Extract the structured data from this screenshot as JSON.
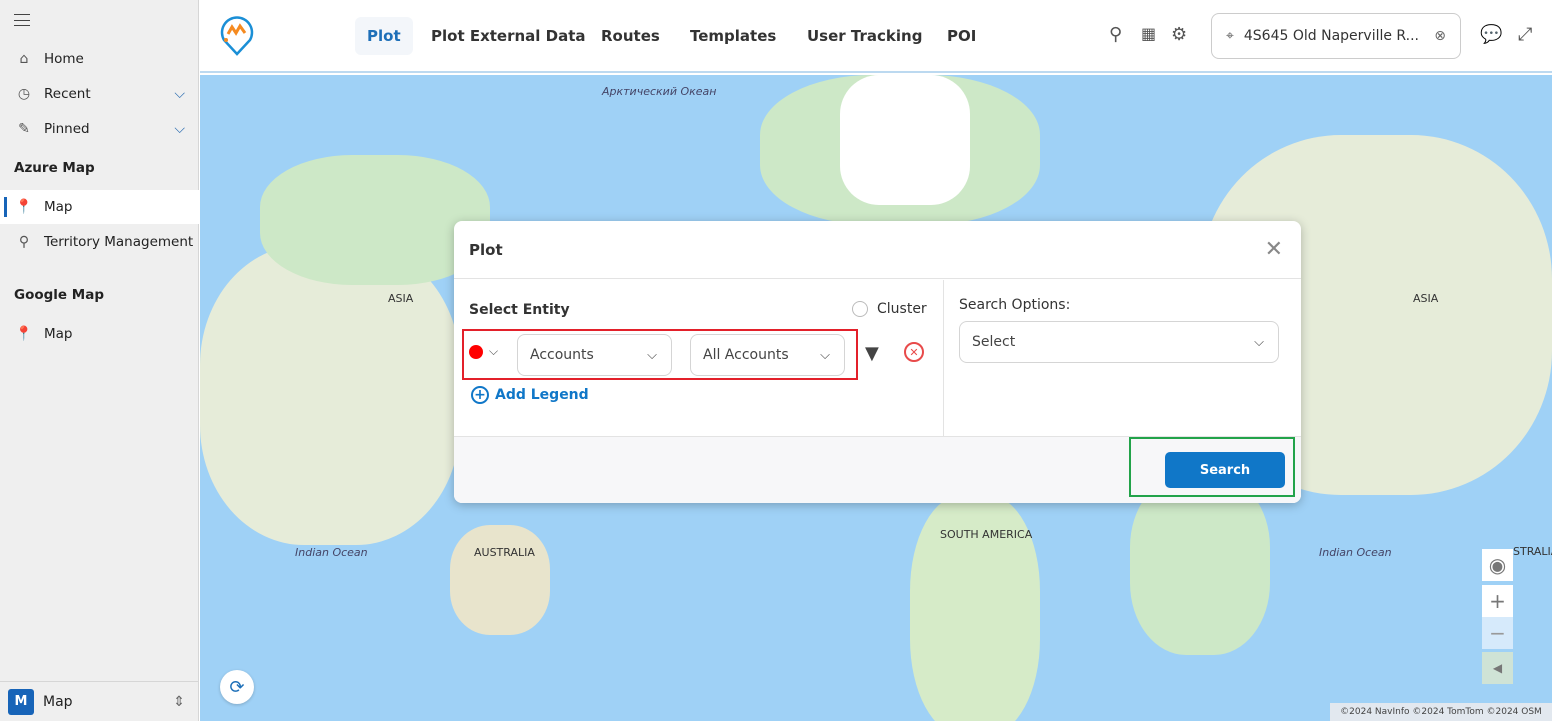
{
  "sidebar": {
    "items": [
      {
        "label": "Home",
        "icon": "home-icon"
      },
      {
        "label": "Recent",
        "icon": "clock-icon"
      },
      {
        "label": "Pinned",
        "icon": "pin-icon"
      }
    ],
    "azure_section": "Azure Map",
    "azure_items": [
      {
        "label": "Map"
      },
      {
        "label": "Territory Management"
      }
    ],
    "google_section": "Google Map",
    "google_items": [
      {
        "label": "Map"
      }
    ],
    "bottom": {
      "badge": "M",
      "label": "Map"
    }
  },
  "header": {
    "tabs": [
      "Plot",
      "Plot External Data",
      "Routes",
      "Templates",
      "User Tracking",
      "POI"
    ],
    "active_tab": "Plot",
    "address": "4S645 Old Naperville R..."
  },
  "map": {
    "labels": {
      "arctic": "Арктический Океан",
      "asia_left": "ASIA",
      "asia_right": "ASIA",
      "indian_left": "Indian Ocean",
      "indian_right": "Indian Ocean",
      "australia": "AUSTRALIA",
      "australia_right": "STRALIA",
      "south_america": "SOUTH AMERICA"
    },
    "copyright": "©2024 NavInfo ©2024 TomTom ©2024 OSM"
  },
  "modal": {
    "title": "Plot",
    "select_entity": "Select Entity",
    "cluster": "Cluster",
    "entity": "Accounts",
    "view": "All Accounts",
    "add_legend": "Add Legend",
    "search_options_label": "Search Options:",
    "search_options_value": "Select",
    "search_button": "Search",
    "marker_color": "#ff0000"
  },
  "colors": {
    "accent": "#1077c8",
    "highlight_red": "#e3202a",
    "highlight_green": "#22a34a"
  }
}
